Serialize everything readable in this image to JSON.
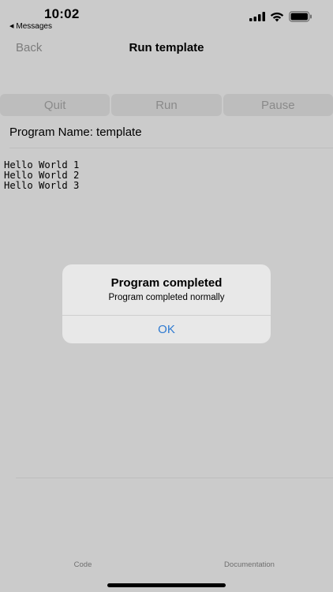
{
  "status_bar": {
    "time": "10:02",
    "back_app": "Messages",
    "icons": [
      "cellular-signal-icon",
      "wifi-icon",
      "battery-icon"
    ]
  },
  "nav": {
    "back_label": "Back",
    "title": "Run template"
  },
  "toolbar": {
    "quit_label": "Quit",
    "run_label": "Run",
    "pause_label": "Pause"
  },
  "program": {
    "name_label": "Program Name: template"
  },
  "console": {
    "lines": [
      "Hello World 1",
      "Hello World 2",
      "Hello World 3"
    ]
  },
  "alert": {
    "title": "Program completed",
    "message": "Program completed normally",
    "ok_label": "OK"
  },
  "tabs": {
    "code_label": "Code",
    "documentation_label": "Documentation"
  },
  "colors": {
    "background": "#cbcbcb",
    "alert_background": "#e8e8e8",
    "accent_blue": "#2e7ad1",
    "disabled_text": "#8a8a8a"
  }
}
